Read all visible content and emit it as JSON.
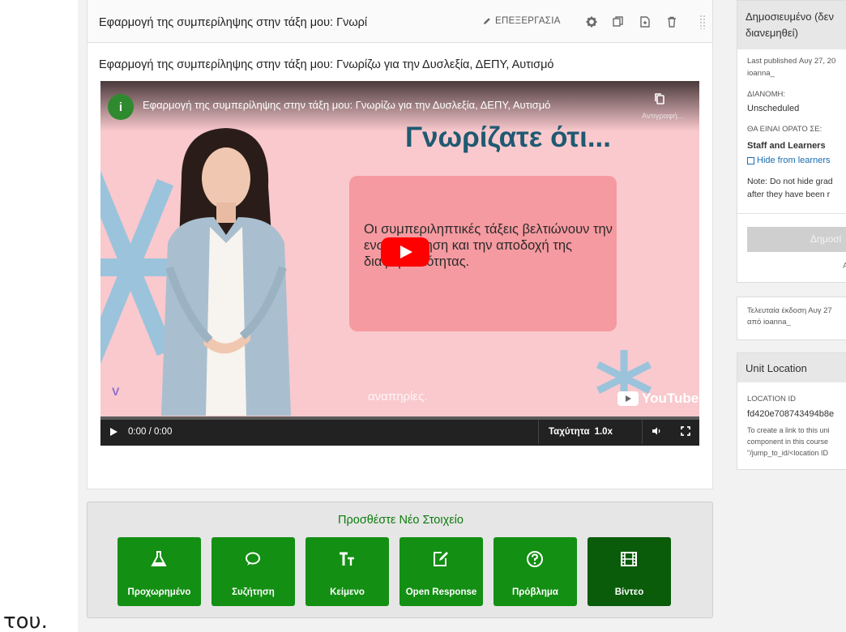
{
  "stray_text": "του.",
  "xblock": {
    "title": "Εφαρμογή της συμπερίληψης στην τάξη μου: Γνωρί",
    "edit_label": "ΕΠΕΞΕΡΓΑΣΙΑ",
    "subtitle": "Εφαρμογή της συμπερίληψης στην τάξη μου: Γνωρίζω για την Δυσλεξία, ΔΕΠΥ, Αυτισμό"
  },
  "video": {
    "channel_initial": "i",
    "title": "Εφαρμογή της συμπερίληψης στην τάξη μου: Γνωρίζω για την Δυσλεξία, ΔΕΠΥ, Αυτισμό",
    "copy_label": "Αντιγραφή...",
    "slide_heading": "Γνωρίζατε ότι...",
    "slide_text": "Οι συμπεριληπτικές τάξεις βελτιώνουν την ενσυναίσθηση και την αποδοχή της διαφορετικότητας.",
    "watermark_logo": "V",
    "watermark_text": "αναπηρίες.",
    "youtube_label": "YouTube",
    "time": "0:00 / 0:00",
    "speed_label": "Ταχύτητα",
    "speed_value": "1.0x",
    "progress": 0
  },
  "add_component": {
    "title": "Προσθέστε Νέο Στοιχείο",
    "buttons": [
      {
        "label": "Προχωρημένο",
        "icon": "flask-icon"
      },
      {
        "label": "Συζήτηση",
        "icon": "speech-bubble-icon"
      },
      {
        "label": "Κείμενο",
        "icon": "text-icon"
      },
      {
        "label": "Open Response",
        "icon": "edit-document-icon"
      },
      {
        "label": "Πρόβλημα",
        "icon": "question-circle-icon"
      },
      {
        "label": "Βίντεο",
        "icon": "film-icon"
      }
    ]
  },
  "sidebar": {
    "status_line1": "Δημοσιευμένο (δεν",
    "status_line2": "διανεμηθεί)",
    "last_published": "Last published Αυγ 27, 20",
    "published_by": "ioanna_",
    "release_label": "ΔΙΑΝΟΜΗ:",
    "release_value": "Unscheduled",
    "visible_label": "ΘΑ ΕΙΝΑΙ ΟΡΑΤΟ ΣΕ:",
    "visible_value": "Staff and Learners",
    "hide_label": "Hide from learners",
    "note_line1": "Note: Do not hide grad",
    "note_line2": "after they have been r",
    "publish_label": "Δημοσί",
    "publish_extra": "Α",
    "last_edit_line1": "Τελευταία έκδοση Αυγ 27",
    "last_edit_line2": "από ioanna_",
    "unit_location_title": "Unit Location",
    "location_id_label": "LOCATION ID",
    "location_id_value": "fd420e708743494b8e",
    "location_help_1": "To create a link to this uni",
    "location_help_2": "component in this course",
    "location_help_3": "\"/jump_to_id/<location ID"
  },
  "colors": {
    "primary_green": "#138f13",
    "dark_green": "#0a5c0a",
    "link_blue": "#1a6db0",
    "youtube_red": "#ff0000",
    "slide_pink": "#f9c9cd"
  }
}
